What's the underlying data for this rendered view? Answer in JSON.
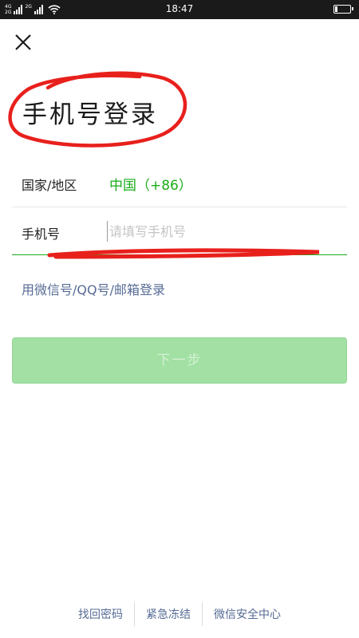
{
  "status_bar": {
    "network_labels": [
      "4G",
      "2G"
    ],
    "network_labels_2": [
      "2G"
    ],
    "time": "18:47",
    "battery_level": 0.2
  },
  "header": {
    "close_icon": "close-icon",
    "title": "手机号登录"
  },
  "form": {
    "country_label": "国家/地区",
    "country_value": "中国（+86）",
    "phone_label": "手机号",
    "phone_placeholder": "请填写手机号",
    "phone_value": ""
  },
  "alt_login_label": "用微信号/QQ号/邮箱登录",
  "next_button_label": "下一步",
  "footer": {
    "links": [
      "找回密码",
      "紧急冻结",
      "微信安全中心"
    ]
  },
  "colors": {
    "accent_green": "#1aad19",
    "button_disabled_green": "#a2e0a4",
    "link_blue": "#576b95",
    "annotation_red": "#e8201c"
  }
}
